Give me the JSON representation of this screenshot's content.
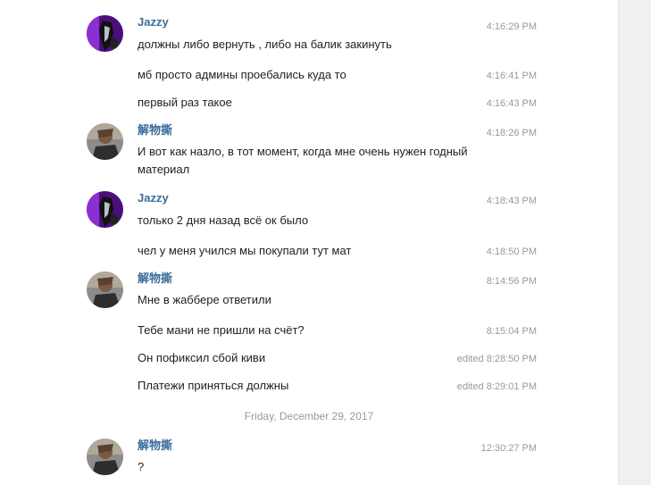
{
  "cutoff_text": "…",
  "groups": [
    {
      "author": "Jazzy",
      "avatar": "jazzy-avatar",
      "messages": [
        {
          "text": "должны либо вернуть , либо на балик закинуть",
          "time": "4:16:29 PM"
        },
        {
          "text": "мб просто админы проебались куда то",
          "time": "4:16:41 PM"
        },
        {
          "text": "первый раз такое",
          "time": "4:16:43 PM"
        }
      ]
    },
    {
      "author": "解物撕",
      "avatar": "user-avatar",
      "messages": [
        {
          "text": "И вот как назло, в тот момент, когда мне очень нужен годный материал",
          "time": "4:18:26 PM"
        }
      ]
    },
    {
      "author": "Jazzy",
      "avatar": "jazzy-avatar",
      "messages": [
        {
          "text": "только 2 дня назад всё ок было",
          "time": "4:18:43 PM"
        },
        {
          "text": "чел у меня учился мы покупали тут мат",
          "time": "4:18:50 PM"
        }
      ]
    },
    {
      "author": "解物撕",
      "avatar": "user-avatar",
      "messages": [
        {
          "text": "Мне в жаббере ответили",
          "time": "8:14:56 PM"
        },
        {
          "text": "Тебе мани не пришли на счёт?",
          "time": "8:15:04 PM"
        },
        {
          "text": "Он пофиксил сбой киви",
          "time": "edited 8:28:50 PM"
        },
        {
          "text": "Платежи приняться должны",
          "time": "edited 8:29:01 PM"
        }
      ]
    }
  ],
  "date_separator": "Friday, December 29, 2017",
  "last_group": {
    "author": "解物撕",
    "avatar": "user-avatar",
    "messages": [
      {
        "text": "?",
        "time": "12:30:27 PM"
      }
    ]
  },
  "colors": {
    "author": "#3a6d99",
    "time": "#999999",
    "jazzy_avatar_bg": "#5b1a8c",
    "user_avatar_bg": "#6b6b6b"
  }
}
